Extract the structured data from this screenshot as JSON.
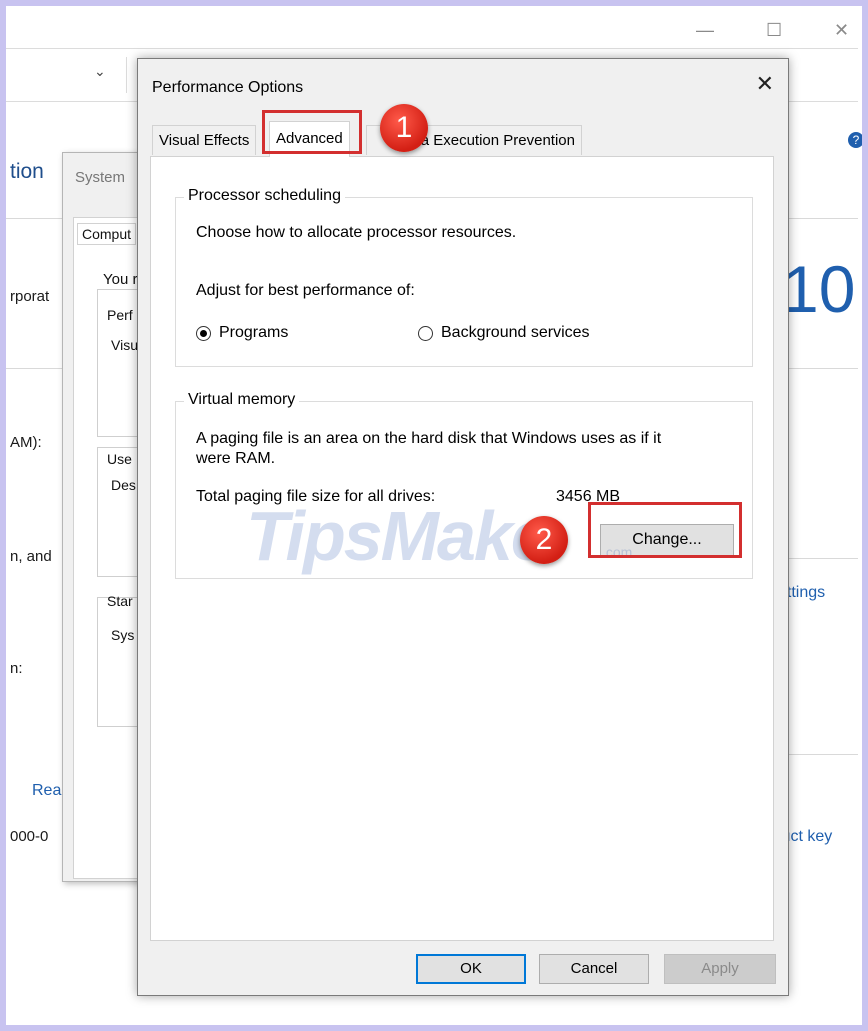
{
  "background": {
    "title_fragment": "tion",
    "partial_labels": [
      "rporat",
      "AM):",
      "n, and",
      "n:",
      "Rea",
      "000-0"
    ],
    "large_digits": "10",
    "right_links": [
      "ettings",
      "luct key"
    ]
  },
  "system_properties": {
    "title": "System",
    "tab": "Comput",
    "intro": "You r",
    "groups": [
      {
        "legend": "Perf",
        "text": "Visu"
      },
      {
        "legend": "Use",
        "text": "Des"
      },
      {
        "legend": "Star",
        "text": "Sys"
      }
    ]
  },
  "dialog": {
    "title": "Performance Options",
    "tabs": [
      {
        "label": "Visual Effects",
        "active": false
      },
      {
        "label": "Advanced",
        "active": true
      },
      {
        "label": "Data Execution Prevention",
        "active": false
      }
    ],
    "processor": {
      "legend": "Processor scheduling",
      "desc": "Choose how to allocate processor resources.",
      "adjust_label": "Adjust for best performance of:",
      "options": [
        {
          "label": "Programs",
          "selected": true
        },
        {
          "label": "Background services",
          "selected": false
        }
      ]
    },
    "virtual_memory": {
      "legend": "Virtual memory",
      "desc_line1": "A paging file is an area on the hard disk that Windows uses as if it",
      "desc_line2": "were RAM.",
      "total_label": "Total paging file size for all drives:",
      "total_value": "3456 MB",
      "change_button": "Change..."
    },
    "buttons": {
      "ok": "OK",
      "cancel": "Cancel",
      "apply": "Apply"
    }
  },
  "annotations": {
    "step1": "1",
    "step2": "2"
  },
  "watermark": {
    "main": "TipsMake",
    "sub": ".com"
  },
  "colors": {
    "highlight": "#d32f2f",
    "badge": "#e53935",
    "focus_border": "#0078d7"
  }
}
